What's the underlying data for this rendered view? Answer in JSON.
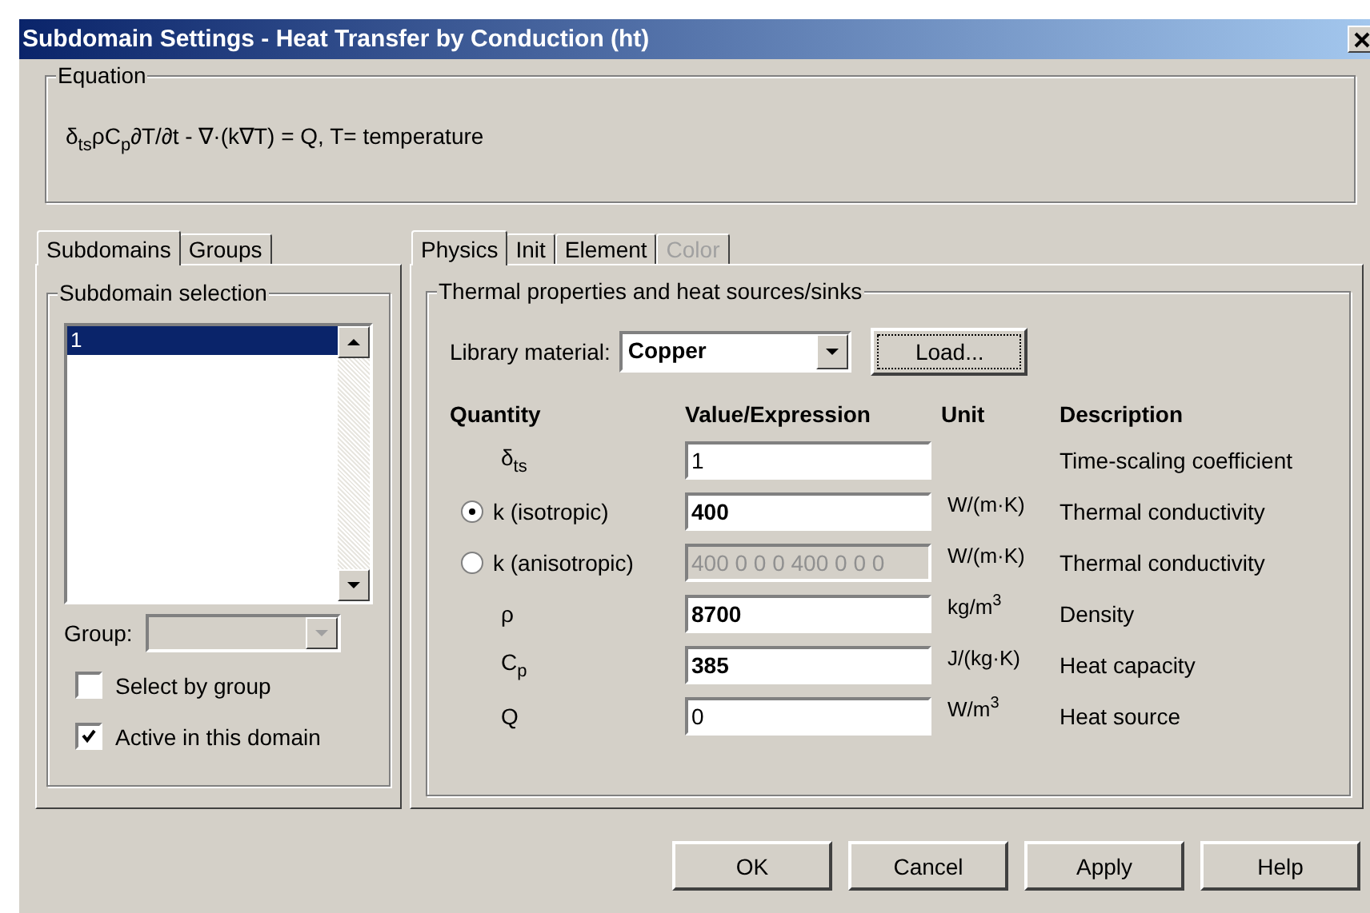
{
  "window": {
    "title": "Subdomain Settings - Heat Transfer by Conduction (ht)"
  },
  "equation": {
    "label": "Equation",
    "text": "δ$_{ts}$ρC$_{p}$∂T/∂t - ∇·(k∇T) = Q, T= temperature"
  },
  "left_tabs": [
    {
      "label": "Subdomains",
      "selected": true
    },
    {
      "label": "Groups",
      "selected": false
    }
  ],
  "subdomain_selection": {
    "label": "Subdomain selection",
    "items": [
      {
        "label": "1",
        "selected": true
      }
    ]
  },
  "group": {
    "label": "Group:",
    "disabled": true
  },
  "checkboxes": [
    {
      "label": "Select by group",
      "checked": false
    },
    {
      "label": "Active in this domain",
      "checked": true
    }
  ],
  "right_tabs": [
    {
      "label": "Physics",
      "selected": true,
      "disabled": false
    },
    {
      "label": "Init",
      "selected": false,
      "disabled": false
    },
    {
      "label": "Element",
      "selected": false,
      "disabled": false
    },
    {
      "label": "Color",
      "selected": false,
      "disabled": true
    }
  ],
  "properties": {
    "label": "Thermal properties and heat sources/sinks",
    "library_label": "Library material:",
    "library_value": "Copper",
    "load_button": "Load...",
    "columns": [
      "Quantity",
      "Value/Expression",
      "Unit",
      "Description"
    ],
    "rows": [
      {
        "kind": "plain",
        "quantity": "δ$_{ts}$",
        "value": "1",
        "emphasized": false,
        "disabled": false,
        "description": "Time-scaling coefficient"
      },
      {
        "kind": "radio",
        "selected": true,
        "quantity": "k (isotropic)",
        "value": "400",
        "emphasized": true,
        "disabled": false,
        "unit": "W/(m·K)",
        "description": "Thermal conductivity"
      },
      {
        "kind": "radio",
        "selected": false,
        "quantity": "k (anisotropic)",
        "value": "400 0 0 0 400 0 0 0",
        "emphasized": false,
        "disabled": true,
        "unit": "W/(m·K)",
        "description": "Thermal conductivity"
      },
      {
        "kind": "plain",
        "quantity": "ρ",
        "value": "8700",
        "emphasized": true,
        "disabled": false,
        "unit": "kg/m$^{3}$",
        "description": "Density"
      },
      {
        "kind": "plain",
        "quantity": "C$_{p}$",
        "value": "385",
        "emphasized": true,
        "disabled": false,
        "unit": "J/(kg·K)",
        "description": "Heat capacity"
      },
      {
        "kind": "plain",
        "quantity": "Q",
        "value": "0",
        "emphasized": false,
        "disabled": false,
        "unit": "W/m$^{3}$",
        "description": "Heat source"
      }
    ]
  },
  "buttons": [
    "OK",
    "Cancel",
    "Apply",
    "Help"
  ]
}
